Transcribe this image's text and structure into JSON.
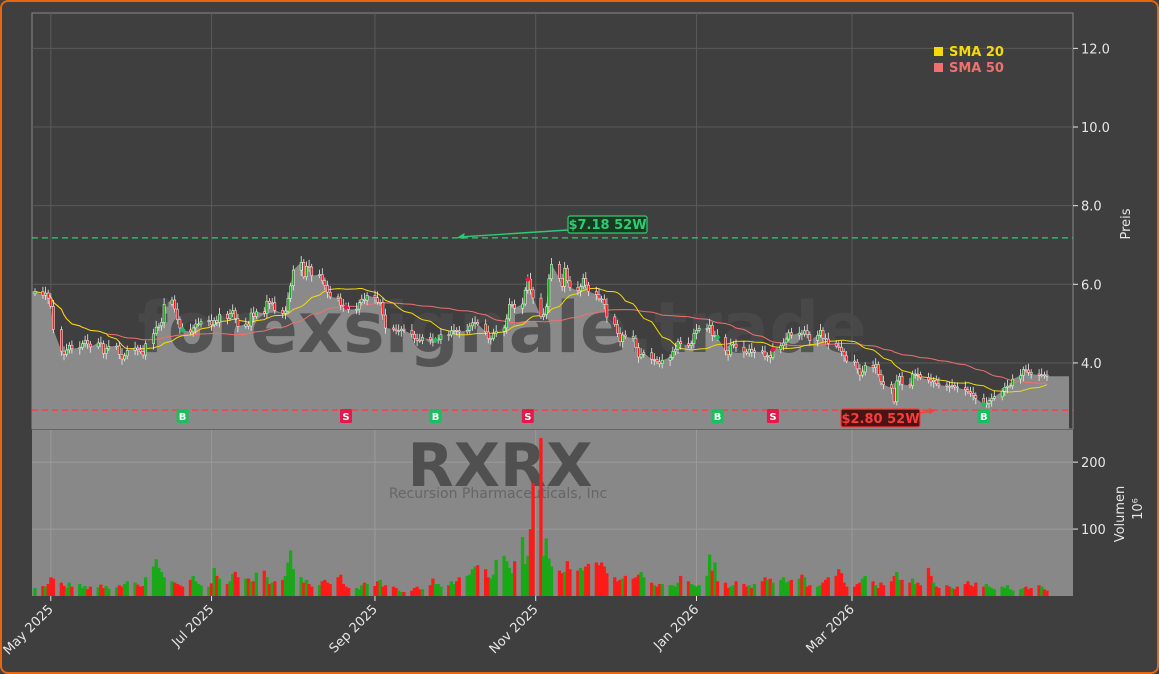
{
  "chart_data": {
    "type": "candlestick",
    "ticker": "RXRX",
    "company": "Recursion Pharmaceuticals, Inc",
    "watermark": "forexsignale.trade",
    "price_axis": {
      "label": "Preis",
      "ylim": [
        2.32,
        12.9
      ],
      "ticks": [
        4.0,
        6.0,
        8.0,
        10.0,
        12.0
      ]
    },
    "volume_axis": {
      "label": "Volumen",
      "unit": "10⁶",
      "ticks": [
        100,
        200
      ]
    },
    "date_ticks": [
      {
        "date": "2025-05-01",
        "label": "May 2025"
      },
      {
        "date": "2025-07-01",
        "label": "Jul 2025"
      },
      {
        "date": "2025-09-01",
        "label": "Sep 2025"
      },
      {
        "date": "2025-11-01",
        "label": "Nov 2025"
      },
      {
        "date": "2026-01-01",
        "label": "Jan 2026"
      },
      {
        "date": "2026-03-01",
        "label": "Mar 2026"
      }
    ],
    "legend": [
      {
        "name": "SMA 20",
        "color": "#f5d90a"
      },
      {
        "name": "SMA 50",
        "color": "#f07070"
      }
    ],
    "annotations": {
      "high_52w": {
        "value": 7.18,
        "label": "$7.18 52W",
        "date": "2025-10-02"
      },
      "low_52w": {
        "value": 2.8,
        "label": "$2.80 52W",
        "date": "2026-04-02"
      }
    },
    "signals": [
      {
        "type": "B",
        "date": "2025-06-20"
      },
      {
        "type": "S",
        "date": "2025-08-21"
      },
      {
        "type": "B",
        "date": "2025-09-24"
      },
      {
        "type": "S",
        "date": "2025-10-29"
      },
      {
        "type": "B",
        "date": "2026-01-09"
      },
      {
        "type": "S",
        "date": "2026-01-30"
      },
      {
        "type": "B",
        "date": "2026-04-20"
      }
    ],
    "colors": {
      "up": "#18a818",
      "down": "#ff1a1a",
      "sma20": "#f5d90a",
      "sma50": "#f07070",
      "high": "#2ecc71",
      "low": "#ff3b3b"
    },
    "series": {
      "start_date": "2025-04-25",
      "close": [
        5.82,
        5.72,
        5.78,
        5.65,
        5.44,
        4.85,
        4.3,
        4.22,
        4.33,
        4.45,
        4.36,
        4.39,
        4.49,
        4.57,
        4.48,
        4.41,
        4.51,
        4.49,
        4.24,
        4.36,
        4.42,
        4.43,
        4.22,
        4.1,
        4.18,
        4.32,
        4.38,
        4.34,
        4.29,
        4.2,
        4.49,
        4.75,
        4.91,
        4.94,
        5.03,
        5.49,
        5.6,
        5.37,
        5.1,
        4.89,
        4.84,
        4.79,
        4.89,
        4.99,
        4.99,
        5.05,
        5.08,
        4.97,
        5.08,
        5.03,
        5.24,
        5.13,
        5.25,
        5.33,
        5.13,
        4.93,
        4.99,
        4.94,
        5.27,
        5.18,
        5.3,
        5.26,
        5.57,
        5.52,
        5.53,
        5.34,
        5.26,
        5.32,
        5.64,
        5.96,
        6.36,
        6.56,
        6.19,
        6.46,
        6.44,
        6.22,
        6.25,
        6.09,
        5.97,
        5.8,
        5.68,
        5.65,
        5.47,
        5.45,
        5.42,
        5.36,
        5.37,
        5.53,
        5.62,
        5.59,
        5.72,
        5.66,
        5.54,
        5.54,
        5.22,
        4.89,
        4.86,
        4.82,
        4.82,
        4.86,
        4.83,
        4.73,
        4.62,
        4.58,
        4.57,
        4.65,
        4.59,
        4.57,
        4.58,
        4.6,
        4.72,
        4.71,
        4.82,
        4.83,
        4.82,
        4.79,
        4.83,
        4.94,
        5.02,
        5.03,
        4.99,
        4.79,
        4.62,
        4.62,
        4.75,
        4.8,
        4.89,
        5.12,
        5.49,
        5.49,
        5.39,
        5.5,
        5.85,
        6.13,
        5.86,
        5.65,
        5.18,
        5.23,
        5.43,
        6.14,
        6.51,
        6.15,
        5.95,
        6.41,
        6.09,
        5.92,
        5.84,
        5.94,
        6.15,
        5.98,
        5.82,
        5.74,
        5.63,
        5.62,
        5.49,
        5.17,
        4.98,
        4.75,
        4.54,
        4.71,
        4.67,
        4.63,
        4.39,
        4.15,
        4.22,
        4.26,
        4.09,
        4.09,
        4.03,
        3.98,
        4.07,
        4.14,
        4.29,
        4.35,
        4.54,
        4.49,
        4.44,
        4.49,
        4.75,
        4.83,
        4.88,
        4.88,
        4.96,
        4.7,
        4.7,
        4.65,
        4.31,
        4.21,
        4.46,
        4.48,
        4.4,
        4.28,
        4.25,
        4.35,
        4.27,
        4.31,
        4.28,
        4.16,
        4.19,
        4.14,
        4.34,
        4.44,
        4.51,
        4.61,
        4.77,
        4.71,
        4.76,
        4.73,
        4.82,
        4.72,
        4.57,
        4.7,
        4.83,
        4.63,
        4.61,
        4.5,
        4.43,
        4.4,
        4.29,
        4.18,
        4.05,
        4.02,
        3.85,
        3.69,
        3.77,
        3.94,
        3.88,
        3.96,
        3.71,
        3.52,
        3.45,
        3.36,
        3.01,
        3.54,
        3.66,
        3.46,
        3.42,
        3.72,
        3.72,
        3.7,
        3.63,
        3.57,
        3.52,
        3.56,
        3.47,
        3.44,
        3.41,
        3.4,
        3.43,
        3.39,
        3.37,
        3.32,
        3.27,
        3.23,
        3.17,
        3.1,
        2.95,
        2.97,
        3.04,
        3.1,
        3.14,
        3.28,
        3.38,
        3.41,
        3.42,
        3.59,
        3.68,
        3.83,
        3.82,
        3.76,
        3.72,
        3.69,
        3.7,
        3.69,
        3.66
      ],
      "volume": [
        12,
        15,
        14,
        18,
        28,
        26,
        20,
        15,
        12,
        20,
        14,
        18,
        12,
        15,
        10,
        14,
        13,
        17,
        12,
        15,
        11,
        13,
        16,
        14,
        18,
        22,
        20,
        17,
        14,
        15,
        28,
        44,
        55,
        42,
        36,
        28,
        22,
        20,
        18,
        16,
        14,
        24,
        30,
        22,
        18,
        16,
        14,
        19,
        42,
        30,
        26,
        18,
        22,
        33,
        36,
        28,
        26,
        26,
        22,
        22,
        35,
        38,
        28,
        18,
        20,
        22,
        24,
        30,
        50,
        68,
        40,
        28,
        20,
        24,
        18,
        14,
        16,
        22,
        24,
        20,
        18,
        28,
        32,
        18,
        14,
        12,
        12,
        10,
        16,
        20,
        18,
        15,
        22,
        24,
        14,
        16,
        14,
        12,
        8,
        6,
        6,
        8,
        12,
        14,
        10,
        10,
        16,
        26,
        18,
        18,
        14,
        16,
        22,
        18,
        22,
        28,
        30,
        32,
        40,
        44,
        46,
        40,
        28,
        26,
        32,
        54,
        60,
        52,
        42,
        34,
        52,
        88,
        48,
        60,
        100,
        168,
        236,
        60,
        86,
        56,
        44,
        38,
        34,
        36,
        52,
        40,
        38,
        42,
        38,
        44,
        48,
        50,
        46,
        50,
        44,
        34,
        28,
        22,
        24,
        26,
        30,
        26,
        28,
        32,
        36,
        28,
        20,
        16,
        14,
        18,
        18,
        16,
        16,
        14,
        20,
        30,
        22,
        18,
        16,
        14,
        16,
        30,
        62,
        38,
        50,
        22,
        20,
        12,
        14,
        16,
        22,
        18,
        14,
        16,
        12,
        18,
        22,
        28,
        24,
        26,
        20,
        24,
        28,
        20,
        22,
        24,
        26,
        32,
        28,
        14,
        16,
        14,
        16,
        20,
        24,
        28,
        30,
        40,
        34,
        20,
        14,
        14,
        18,
        20,
        26,
        30,
        22,
        16,
        12,
        20,
        16,
        22,
        30,
        36,
        24,
        24,
        20,
        26,
        18,
        20,
        16,
        42,
        30,
        20,
        14,
        12,
        16,
        14,
        12,
        10,
        14,
        18,
        22,
        16,
        14,
        20,
        14,
        18,
        14,
        12,
        10,
        14,
        12,
        16,
        10,
        8,
        10,
        12,
        14,
        10,
        12,
        16,
        14,
        10,
        8,
        8,
        6,
        10,
        12,
        10,
        14,
        10,
        10,
        12,
        8,
        10,
        12,
        10,
        12
      ]
    }
  }
}
